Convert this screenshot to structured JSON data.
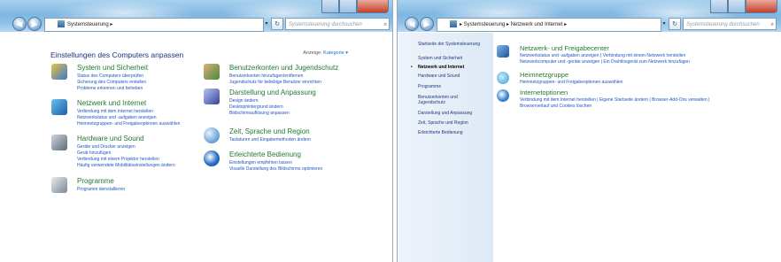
{
  "left_window": {
    "address": {
      "crumb": "Systemsteuerung ▸"
    },
    "search_placeholder": "Systemsteuerung durchsuchen",
    "heading": "Einstellungen des Computers anpassen",
    "view_by_label": "Anzeige:",
    "view_by_value": "Kategorie ▾",
    "categories": [
      {
        "title": "System und Sicherheit",
        "icon": "shield-pc-icon",
        "color": "#3a78c8",
        "links": [
          "Status des Computers überprüfen",
          "Sicherung des Computers erstellen",
          "Probleme erkennen und beheben"
        ]
      },
      {
        "title": "Netzwerk und Internet",
        "icon": "network-globe-icon",
        "color": "#2f8fd0",
        "links": [
          "Verbindung mit dem Internet herstellen",
          "Netzwerkstatus und -aufgaben anzeigen",
          "Heimnetzgruppen- und Freigabeoptionen auswählen"
        ]
      },
      {
        "title": "Hardware und Sound",
        "icon": "printer-icon",
        "color": "#7a8a9a",
        "links": [
          "Geräte und Drucker anzeigen",
          "Gerät hinzufügen",
          "Verbindung mit einem Projektor herstellen",
          "Häufig verwendete Mobilitätseinstellungen ändern"
        ]
      },
      {
        "title": "Programme",
        "icon": "programs-icon",
        "color": "#8a9aa8",
        "links": [
          "Programm deinstallieren"
        ]
      },
      {
        "title": "Benutzerkonten und Jugendschutz",
        "icon": "users-icon",
        "color": "#4c8a3a",
        "links": [
          "Benutzerkonten hinzufügen/entfernen",
          "Jugendschutz für beliebige Benutzer einrichten"
        ]
      },
      {
        "title": "Darstellung und Anpassung",
        "icon": "appearance-icon",
        "color": "#5b6fc0",
        "links": [
          "Design ändern",
          "Desktophintergrund ändern",
          "Bildschirmauflösung anpassen"
        ]
      },
      {
        "title": "Zeit, Sprache und Region",
        "icon": "clock-globe-icon",
        "color": "#2f7ac0",
        "links": [
          "Tastaturen und Eingabemethoden ändern"
        ]
      },
      {
        "title": "Erleichterte Bedienung",
        "icon": "ease-of-access-icon",
        "color": "#2a6fc6",
        "links": [
          "Einstellungen empfehlen lassen",
          "Visuelle Darstellung des Bildschirms optimieren"
        ]
      }
    ]
  },
  "right_window": {
    "address": {
      "crumb": "▸ Systemsteuerung ▸ Netzwerk und Internet ▸"
    },
    "search_placeholder": "Systemsteuerung durchsuchen",
    "sidebar": [
      "Startseite der Systemsteuerung",
      "System und Sicherheit",
      "Netzwerk und Internet",
      "Hardware und Sound",
      "Programme",
      "Benutzerkonten und Jugendschutz",
      "Darstellung und Anpassung",
      "Zeit, Sprache und Region",
      "Erleichterte Bedienung"
    ],
    "sections": [
      {
        "title": "Netzwerk- und Freigabecenter",
        "icon": "network-center-icon",
        "color": "#3d7bc4",
        "link_rows": [
          "Netzwerkstatus und -aufgaben anzeigen  |  Verbindung mit einem Netzwerk herstellen",
          "Netzwerkcomputer und -geräte anzeigen  |  Ein Drahtlosgerät zum Netzwerk hinzufügen"
        ]
      },
      {
        "title": "Heimnetzgruppe",
        "icon": "homegroup-icon",
        "color": "#2f9ad0",
        "link_rows": [
          "Heimnetzgruppen- und Freigabeoptionen auswählen"
        ]
      },
      {
        "title": "Internetoptionen",
        "icon": "internet-options-icon",
        "color": "#3b8ad6",
        "link_rows": [
          "Verbindung mit dem Internet herstellen  |  Eigene Startseite ändern  |  Browser-Add-Ons verwalten  |",
          "Browserverlauf und Cookies löschen"
        ]
      }
    ]
  }
}
